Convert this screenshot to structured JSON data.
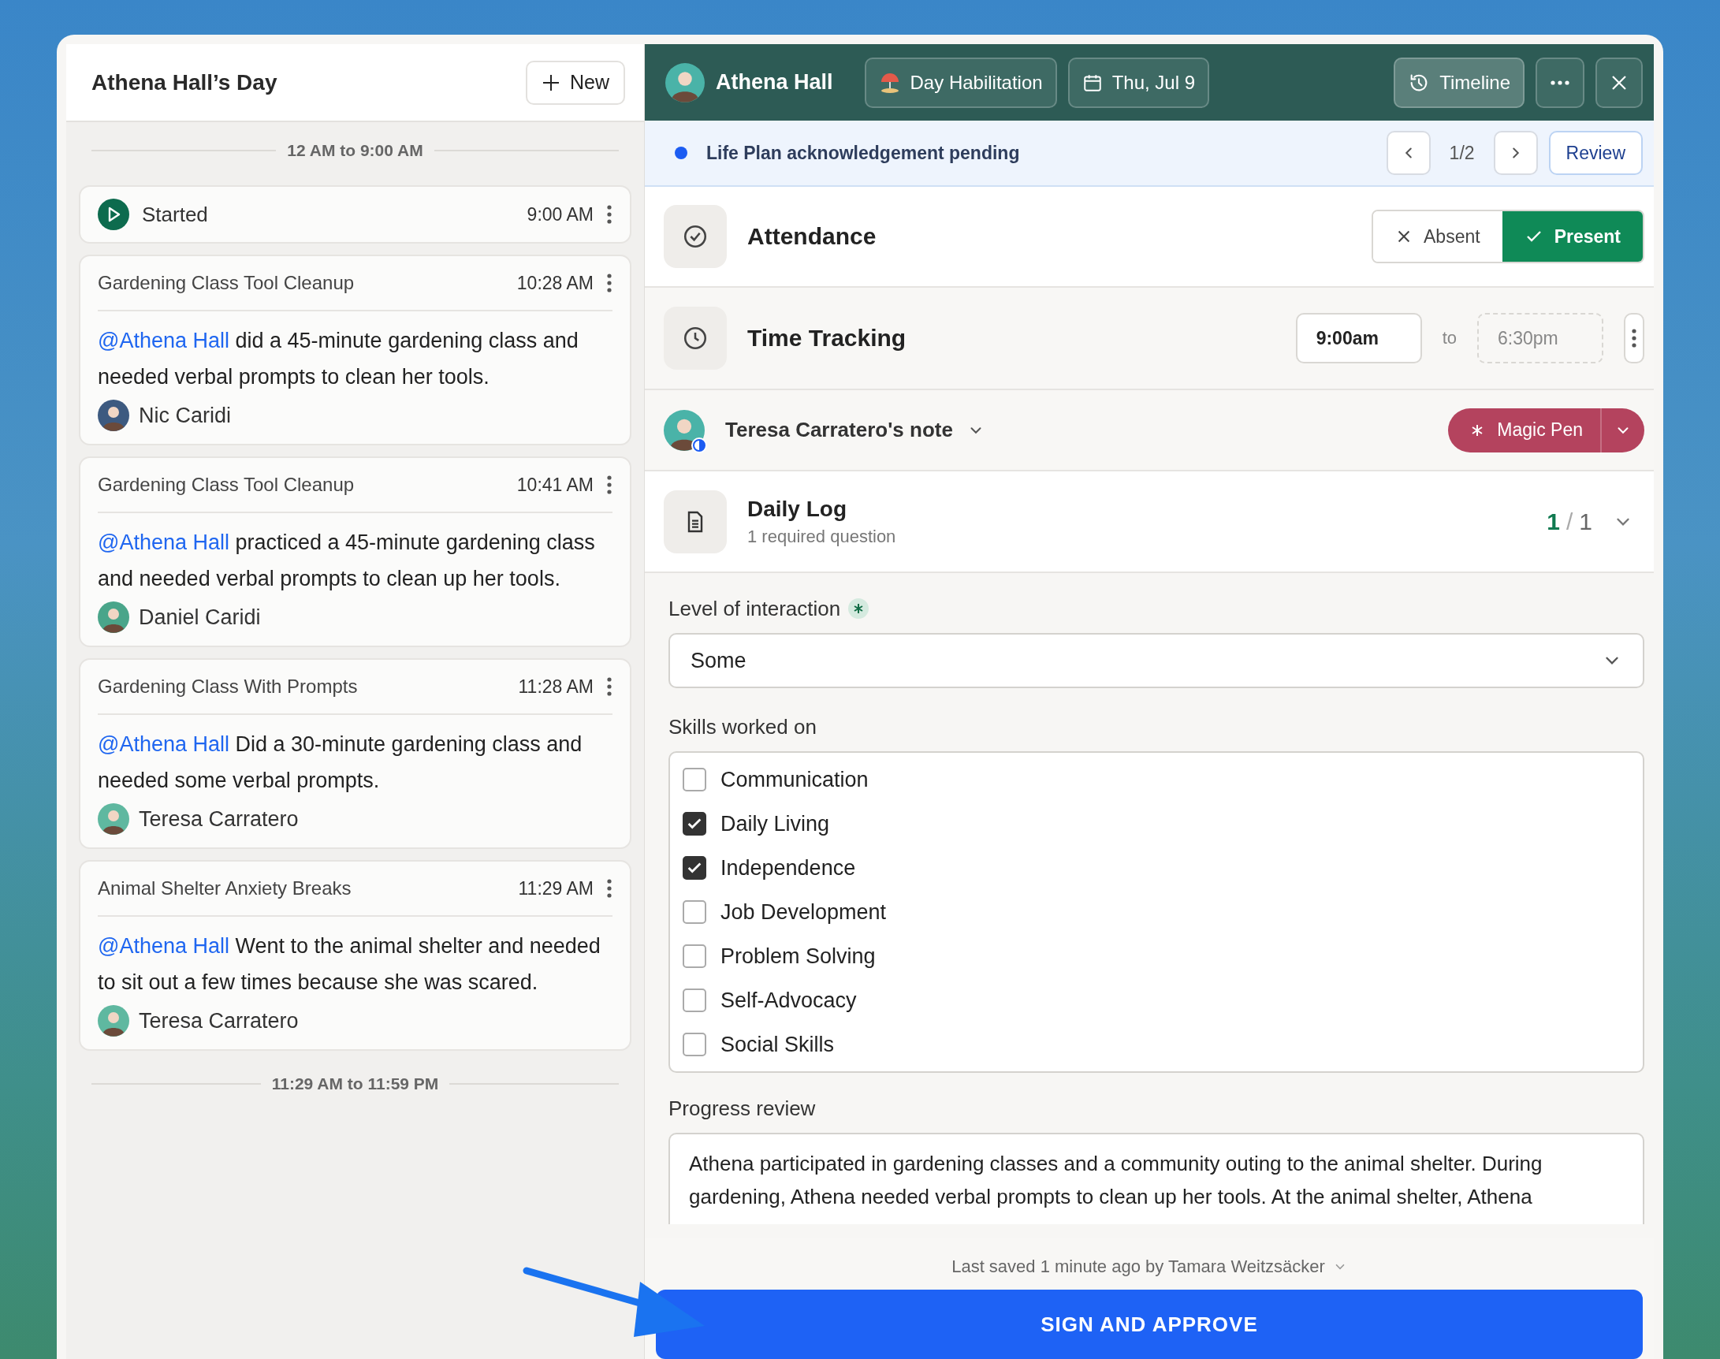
{
  "day_panel": {
    "title": "Athena Hall’s Day",
    "new_button": "New",
    "timeline": [
      {
        "kind": "divider",
        "text": "12 AM to 9:00 AM"
      },
      {
        "kind": "status",
        "label": "Started",
        "time": "9:00 AM"
      },
      {
        "kind": "note",
        "title": "Gardening Class Tool Cleanup",
        "time": "10:28 AM",
        "mention": "@Athena Hall",
        "text": "did a 45-minute gardening class and needed verbal prompts to clean her tools.",
        "author": "Nic Caridi"
      },
      {
        "kind": "note",
        "title": "Gardening Class Tool Cleanup",
        "time": "10:41 AM",
        "mention": "@Athena Hall",
        "text": "practiced a 45-minute gardening class and needed verbal prompts to clean up her tools.",
        "author": "Daniel Caridi"
      },
      {
        "kind": "note",
        "title": "Gardening Class With Prompts",
        "time": "11:28 AM",
        "mention": "@Athena Hall",
        "text": "Did a 30-minute gardening class and needed some verbal prompts.",
        "author": "Teresa Carratero"
      },
      {
        "kind": "note",
        "title": "Animal Shelter Anxiety Breaks",
        "time": "11:29 AM",
        "mention": "@Athena Hall",
        "text": "Went to the animal shelter and needed to sit out a few times because she was scared.",
        "author": "Teresa Carratero"
      },
      {
        "kind": "divider",
        "text": "11:29 AM to 11:59 PM"
      }
    ]
  },
  "header": {
    "name": "Athena Hall",
    "service": "Day Habilitation",
    "date": "Thu, Jul 9",
    "timeline_button": "Timeline"
  },
  "banner": {
    "text": "Life Plan acknowledgement pending",
    "pager": "1/2",
    "review_button": "Review"
  },
  "attendance": {
    "title": "Attendance",
    "options": [
      {
        "label": "Absent",
        "selected": false
      },
      {
        "label": "Present",
        "selected": true
      }
    ]
  },
  "time_tracking": {
    "title": "Time Tracking",
    "start": "9:00am",
    "separator": "to",
    "end": {
      "placeholder": "6:30pm"
    }
  },
  "note": {
    "author": "Teresa Carratero's note",
    "magic_pen_button": "Magic Pen"
  },
  "daily_log": {
    "title": "Daily Log",
    "subtitle": "1 required question",
    "done": "1",
    "separator": "/",
    "total": "1"
  },
  "form": {
    "interaction": {
      "label": "Level of interaction",
      "required": true,
      "value": "Some"
    },
    "skills": {
      "label": "Skills worked on",
      "options": [
        {
          "label": "Communication",
          "checked": false
        },
        {
          "label": "Daily Living",
          "checked": true
        },
        {
          "label": "Independence",
          "checked": true
        },
        {
          "label": "Job Development",
          "checked": false
        },
        {
          "label": "Problem Solving",
          "checked": false
        },
        {
          "label": "Self-Advocacy",
          "checked": false
        },
        {
          "label": "Social Skills",
          "checked": false
        }
      ]
    },
    "progress_review": {
      "label": "Progress review",
      "value": "Athena participated in gardening classes and a community outing to the animal shelter. During gardening, Athena needed verbal prompts to clean up her tools. At the animal shelter, Athena"
    }
  },
  "footer": {
    "last_saved": "Last saved 1 minute ago by Tamara Weitzsäcker",
    "sign_button": "SIGN AND APPROVE"
  }
}
